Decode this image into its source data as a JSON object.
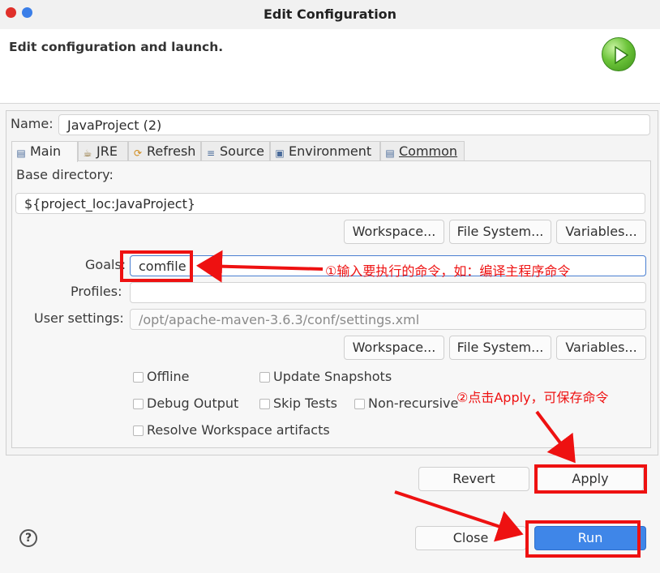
{
  "window": {
    "title": "Edit Configuration"
  },
  "header": {
    "text": "Edit configuration and launch.",
    "icon": "run-launch-icon"
  },
  "name": {
    "label": "Name:",
    "value": "JavaProject (2)"
  },
  "tabs": [
    {
      "label": "Main",
      "icon": "main-tab-icon",
      "active": true
    },
    {
      "label": "JRE",
      "icon": "jre-tab-icon"
    },
    {
      "label": "Refresh",
      "icon": "refresh-tab-icon"
    },
    {
      "label": "Source",
      "icon": "source-tab-icon"
    },
    {
      "label": "Environment",
      "icon": "environment-tab-icon"
    },
    {
      "label": "Common",
      "icon": "common-tab-icon"
    }
  ],
  "main": {
    "base_dir_label": "Base directory:",
    "base_dir_value": "${project_loc:JavaProject}",
    "buttons1": {
      "workspace": "Workspace...",
      "filesystem": "File System...",
      "variables": "Variables..."
    },
    "goals_label": "Goals:",
    "goals_value": "comfile",
    "profiles_label": "Profiles:",
    "profiles_value": "",
    "user_settings_label": "User settings:",
    "user_settings_value": "/opt/apache-maven-3.6.3/conf/settings.xml",
    "buttons2": {
      "workspace": "Workspace...",
      "filesystem": "File System...",
      "variables": "Variables..."
    },
    "checks": {
      "offline": "Offline",
      "update_snapshots": "Update Snapshots",
      "debug_output": "Debug Output",
      "skip_tests": "Skip Tests",
      "non_recursive": "Non-recursive",
      "resolve_workspace": "Resolve Workspace artifacts"
    }
  },
  "actions": {
    "revert": "Revert",
    "apply": "Apply",
    "close": "Close",
    "run": "Run",
    "help": "?"
  },
  "annotations": {
    "goals_note": "①输入要执行的命令，如：编译主程序命令",
    "apply_note": "②点击Apply，可保存命令"
  },
  "colors": {
    "annotation": "#ee1111",
    "primary": "#3f86e8",
    "close_dot": "#e0302a",
    "min_dot": "#3a7ee8"
  }
}
